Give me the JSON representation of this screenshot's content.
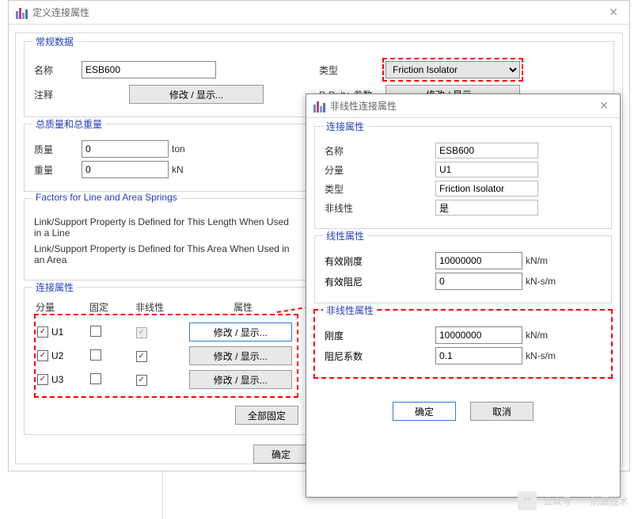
{
  "main": {
    "title": "定义连接属性",
    "groups": {
      "general": {
        "legend": "常规数据",
        "name_label": "名称",
        "name_value": "ESB600",
        "type_label": "类型",
        "type_value": "Friction Isolator",
        "note_label": "注释",
        "note_btn": "修改 / 显示...",
        "pdelta_label": "P-Delta 参数",
        "pdelta_btn": "修改 / 显示..."
      },
      "mass": {
        "legend": "总质量和总重量",
        "mass_label": "质量",
        "mass_value": "0",
        "mass_unit": "ton",
        "weight_label": "重量",
        "weight_value": "0",
        "weight_unit": "kN"
      },
      "factors": {
        "legend": "Factors for Line and Area Springs",
        "line_text": "Link/Support Property is Defined for This Length When Used in a Line",
        "area_text": "Link/Support Property is Defined for This Area When Used in an Area"
      },
      "conn": {
        "legend": "连接属性",
        "hdr_dir": "分量",
        "hdr_fix": "固定",
        "hdr_nl": "非线性",
        "hdr_prop": "属性",
        "rows": [
          {
            "dir": "U1",
            "checked": true,
            "fixed": false,
            "nl": true,
            "nl_disabled": true
          },
          {
            "dir": "U2",
            "checked": true,
            "fixed": false,
            "nl": true,
            "nl_disabled": false
          },
          {
            "dir": "U3",
            "checked": true,
            "fixed": false,
            "nl": true,
            "nl_disabled": false
          }
        ],
        "prop_btn": "修改 / 显示...",
        "all_fixed_btn": "全部固定"
      }
    },
    "ok_btn": "确定"
  },
  "sub": {
    "title": "非线性连接属性",
    "groups": {
      "conn": {
        "legend": "连接属性",
        "name_label": "名称",
        "name_value": "ESB600",
        "dir_label": "分量",
        "dir_value": "U1",
        "type_label": "类型",
        "type_value": "Friction Isolator",
        "nl_label": "非线性",
        "nl_value": "是"
      },
      "linear": {
        "legend": "线性属性",
        "stiff_label": "有效刚度",
        "stiff_value": "10000000",
        "stiff_unit": "kN/m",
        "damp_label": "有效阻尼",
        "damp_value": "0",
        "damp_unit": "kN-s/m"
      },
      "nonlinear": {
        "legend": "非线性属性",
        "stiff_label": "刚度",
        "stiff_value": "10000000",
        "stiff_unit": "kN/m",
        "damp_label": "阻尼系数",
        "damp_value": "0.1",
        "damp_unit": "kN-s/m"
      }
    },
    "ok_btn": "确定",
    "cancel_btn": "取消"
  },
  "watermark": {
    "text1": "公众号",
    "text2": "防震技术"
  }
}
